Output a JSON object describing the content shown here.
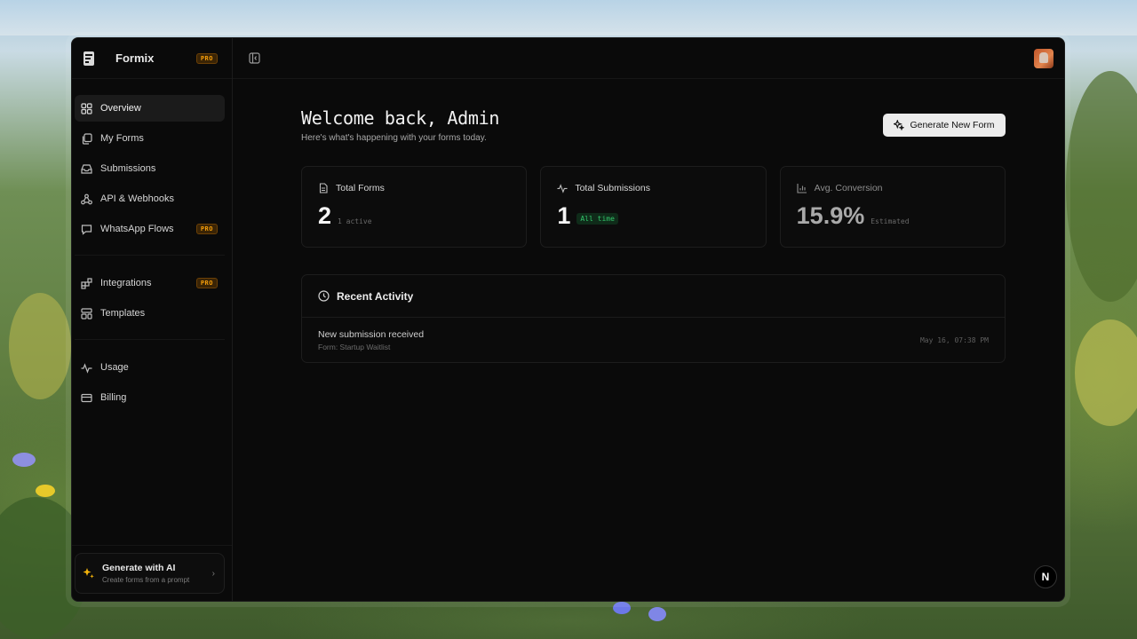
{
  "brand": {
    "name": "Formix",
    "badge": "PRO"
  },
  "sidebar": {
    "groups": [
      [
        {
          "label": "Overview",
          "icon": "grid-icon",
          "active": true
        },
        {
          "label": "My Forms",
          "icon": "copy-icon"
        },
        {
          "label": "Submissions",
          "icon": "inbox-icon"
        },
        {
          "label": "API & Webhooks",
          "icon": "webhook-icon"
        },
        {
          "label": "WhatsApp Flows",
          "icon": "message-icon",
          "badge": "PRO"
        }
      ],
      [
        {
          "label": "Integrations",
          "icon": "blocks-icon",
          "badge": "PRO"
        },
        {
          "label": "Templates",
          "icon": "layout-icon"
        }
      ],
      [
        {
          "label": "Usage",
          "icon": "activity-icon"
        },
        {
          "label": "Billing",
          "icon": "card-icon"
        }
      ]
    ],
    "ai_card": {
      "title": "Generate with AI",
      "subtitle": "Create forms from a prompt"
    }
  },
  "header": {
    "welcome": "Welcome back, Admin",
    "subtitle": "Here's what's happening with your forms today.",
    "generate_button": "Generate New Form"
  },
  "stats": [
    {
      "label": "Total Forms",
      "value": "2",
      "note": "1 active"
    },
    {
      "label": "Total Submissions",
      "value": "1",
      "badge": "All time"
    },
    {
      "label": "Avg. Conversion",
      "value": "15.9%",
      "note": "Estimated"
    }
  ],
  "activity": {
    "title": "Recent Activity",
    "items": [
      {
        "title": "New submission received",
        "subtitle": "Form: Startup Waitlist",
        "time": "May 16, 07:38 PM"
      }
    ]
  },
  "corner_badge": "N",
  "colors": {
    "accent_pro": "#f59e0b",
    "success": "#33c46b",
    "background": "#0a0a0a"
  }
}
